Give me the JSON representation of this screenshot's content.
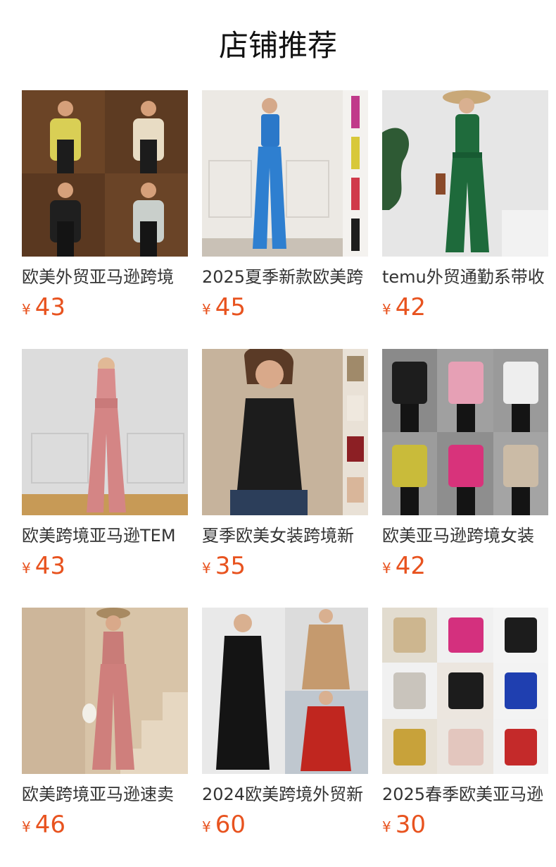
{
  "section_title": "店铺推荐",
  "currency": "¥",
  "products": [
    {
      "name": "欧美外贸亚马逊跨境",
      "price": "43",
      "image": "product-photo-yellow-and-black-jackets"
    },
    {
      "name": "2025夏季新款欧美跨",
      "price": "45",
      "image": "product-photo-blue-vest-wide-pants"
    },
    {
      "name": "temu外贸通勤系带收",
      "price": "42",
      "image": "product-photo-green-jumpsuit"
    },
    {
      "name": "欧美跨境亚马逊TEM",
      "price": "43",
      "image": "product-photo-pink-jumpsuit-wall"
    },
    {
      "name": "夏季欧美女装跨境新",
      "price": "35",
      "image": "product-photo-black-sleeveless-top"
    },
    {
      "name": "欧美亚马逊跨境女装",
      "price": "42",
      "image": "product-photo-sequin-blazers-grid"
    },
    {
      "name": "欧美跨境亚马逊速卖",
      "price": "46",
      "image": "product-photo-pink-jumpsuit-stairs"
    },
    {
      "name": "2024欧美跨境外贸新",
      "price": "60",
      "image": "product-photo-black-tan-red-coats"
    },
    {
      "name": "2025春季欧美亚马逊",
      "price": "30",
      "image": "product-photo-sequin-jackets-colors"
    }
  ]
}
